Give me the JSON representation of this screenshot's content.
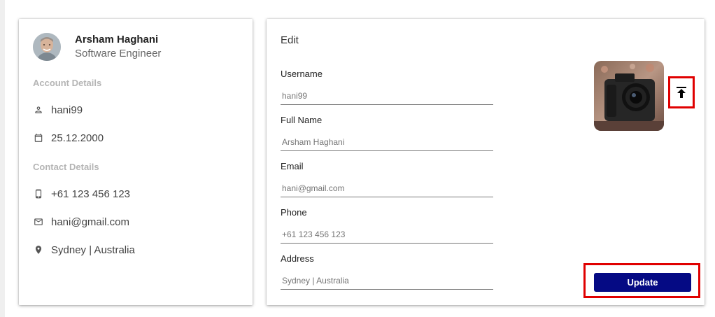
{
  "profile": {
    "name": "Arsham Haghani",
    "role": "Software Engineer",
    "account_section_title": "Account Details",
    "contact_section_title": "Contact Details",
    "account_details": [
      {
        "icon": "person-icon",
        "value": "hani99"
      },
      {
        "icon": "calendar-icon",
        "value": "25.12.2000"
      }
    ],
    "contact_details": [
      {
        "icon": "phone-icon",
        "value": "+61 123 456 123"
      },
      {
        "icon": "mail-icon",
        "value": "hani@gmail.com"
      },
      {
        "icon": "location-pin-icon",
        "value": "Sydney | Australia"
      }
    ]
  },
  "edit": {
    "title": "Edit",
    "fields": [
      {
        "label": "Username",
        "placeholder": "hani99"
      },
      {
        "label": "Full Name",
        "placeholder": "Arsham Haghani"
      },
      {
        "label": "Email",
        "placeholder": "hani@gmail.com"
      },
      {
        "label": "Phone",
        "placeholder": "+61 123 456 123"
      },
      {
        "label": "Address",
        "placeholder": "Sydney | Australia"
      }
    ],
    "upload_icon": "upload-icon",
    "update_label": "Update"
  },
  "colors": {
    "primary_button": "#050a84",
    "highlight_border": "#e00000",
    "section_title": "#b5b5b5"
  }
}
